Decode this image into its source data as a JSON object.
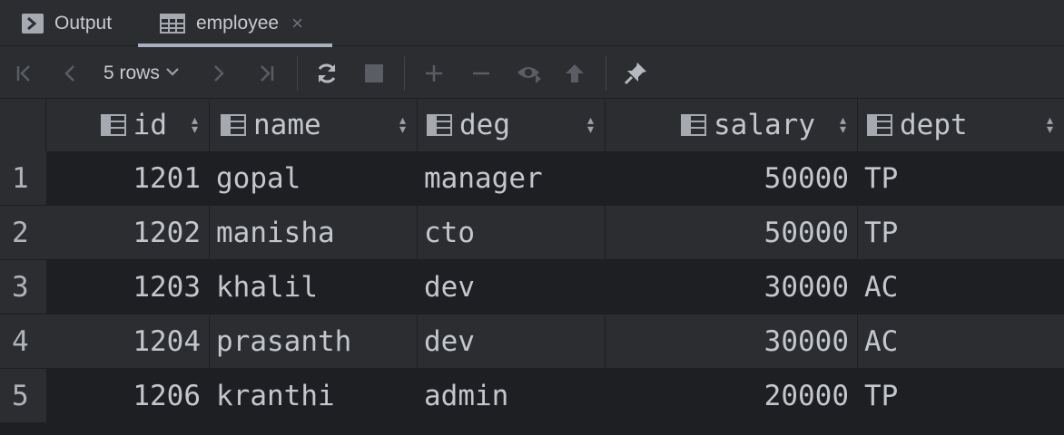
{
  "tabs": [
    {
      "label": "Output",
      "icon": "console-icon"
    },
    {
      "label": "employee",
      "icon": "table-icon",
      "close": "×"
    }
  ],
  "toolbar": {
    "rows_label": "5 rows",
    "buttons": [
      "first-page",
      "previous-page",
      "next-page",
      "last-page",
      "reload",
      "stop",
      "add-row",
      "delete-row",
      "preview-changes",
      "submit",
      "pin"
    ]
  },
  "table": {
    "columns": [
      "id",
      "name",
      "deg",
      "salary",
      "dept"
    ],
    "rows": [
      {
        "num": "1",
        "id": "1201",
        "name": "gopal",
        "deg": "manager",
        "salary": "50000",
        "dept": "TP"
      },
      {
        "num": "2",
        "id": "1202",
        "name": "manisha",
        "deg": "cto",
        "salary": "50000",
        "dept": "TP"
      },
      {
        "num": "3",
        "id": "1203",
        "name": "khalil",
        "deg": "dev",
        "salary": "30000",
        "dept": "AC"
      },
      {
        "num": "4",
        "id": "1204",
        "name": "prasanth",
        "deg": "dev",
        "salary": "30000",
        "dept": "AC"
      },
      {
        "num": "5",
        "id": "1206",
        "name": "kranthi",
        "deg": "admin",
        "salary": "20000",
        "dept": "TP"
      }
    ]
  },
  "colors": {
    "background": "#2b2d30",
    "grid_dark": "#1e1f22",
    "text": "#c3c6cc",
    "disabled": "#5a5d63"
  }
}
